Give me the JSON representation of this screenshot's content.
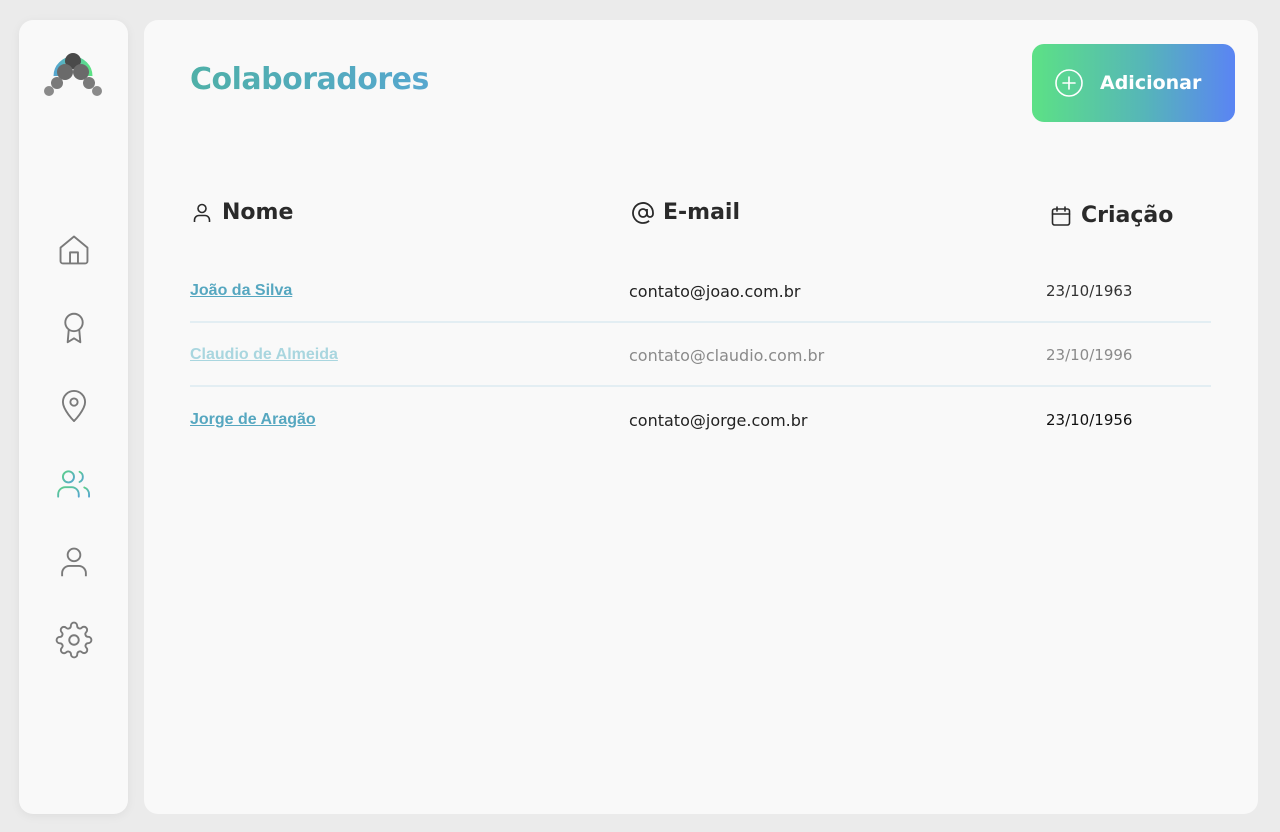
{
  "colors": {
    "accent": "#56a7c0",
    "accent_green": "#5ce185",
    "accent_blue": "#5a84f4",
    "active_icon_green": "#5ccf8a",
    "active_icon_blue": "#56a7cf",
    "inactive_icon": "#7a7a7a"
  },
  "sidebar": {
    "logo_icon": "dumbbell-icon",
    "items": [
      {
        "icon": "home-icon",
        "active": false
      },
      {
        "icon": "award-icon",
        "active": false
      },
      {
        "icon": "map-pin-icon",
        "active": false
      },
      {
        "icon": "users-icon",
        "active": true
      },
      {
        "icon": "user-icon",
        "active": false
      },
      {
        "icon": "gear-icon",
        "active": false
      }
    ]
  },
  "header": {
    "title": "Colaboradores",
    "add_button_label": "Adicionar",
    "add_button_icon": "plus-circle-icon"
  },
  "table": {
    "columns": [
      {
        "label": "Nome",
        "icon": "user-icon"
      },
      {
        "label": "E-mail",
        "icon": "at-sign-icon"
      },
      {
        "label": "Criação",
        "icon": "calendar-icon"
      }
    ],
    "rows": [
      {
        "name": "João da Silva",
        "email": "contato@joao.com.br",
        "created": "23/10/1963"
      },
      {
        "name": "Claudio de Almeida",
        "email": "contato@claudio.com.br",
        "created": "23/10/1996"
      },
      {
        "name": "Jorge de Aragão",
        "email": "contato@jorge.com.br",
        "created": "23/10/1956"
      }
    ]
  }
}
